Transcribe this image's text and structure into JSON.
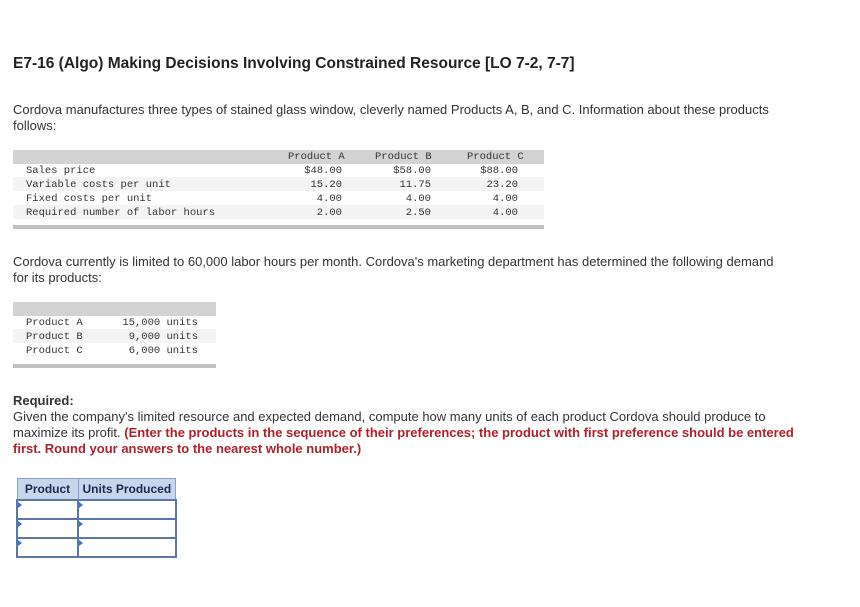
{
  "header": {
    "title": "E7-16 (Algo) Making Decisions Involving Constrained Resource [LO 7-2, 7-7]"
  },
  "intro": {
    "line1": "Cordova manufactures three types of stained glass window, cleverly named Products A, B, and C. Information about these products",
    "line2": "follows:"
  },
  "product_table": {
    "columns": [
      "Product A",
      "Product B",
      "Product C"
    ],
    "rows": [
      {
        "label": "Sales price",
        "values": [
          "$48.00",
          "$58.00",
          "$88.00"
        ]
      },
      {
        "label": "Variable costs per unit",
        "values": [
          "15.20",
          "11.75",
          "23.20"
        ]
      },
      {
        "label": "Fixed costs per unit",
        "values": [
          "4.00",
          "4.00",
          "4.00"
        ]
      },
      {
        "label": "Required number of labor hours",
        "values": [
          "2.00",
          "2.50",
          "4.00"
        ]
      }
    ]
  },
  "constraint": {
    "line1": "Cordova currently is limited to 60,000 labor hours per month. Cordova's marketing department has determined the following demand",
    "line2": "for its products:"
  },
  "demand_table": {
    "rows": [
      {
        "label": "Product A",
        "value": "15,000 units"
      },
      {
        "label": "Product B",
        "value": "9,000 units"
      },
      {
        "label": "Product C",
        "value": "6,000 units"
      }
    ]
  },
  "required": {
    "label": "Required:",
    "text1": "Given the company's limited resource and expected demand, compute how many units of each product Cordova should produce to",
    "text2_plain": "maximize its profit. ",
    "text2_red": "(Enter the products in the sequence of their preferences; the product with first preference should be entered",
    "text3_red": "first. Round your answers to the nearest whole number.)"
  },
  "answer_table": {
    "headers": [
      "Product",
      "Units Produced"
    ],
    "rows": [
      {
        "product": "",
        "units": ""
      },
      {
        "product": "",
        "units": ""
      },
      {
        "product": "",
        "units": ""
      }
    ]
  }
}
